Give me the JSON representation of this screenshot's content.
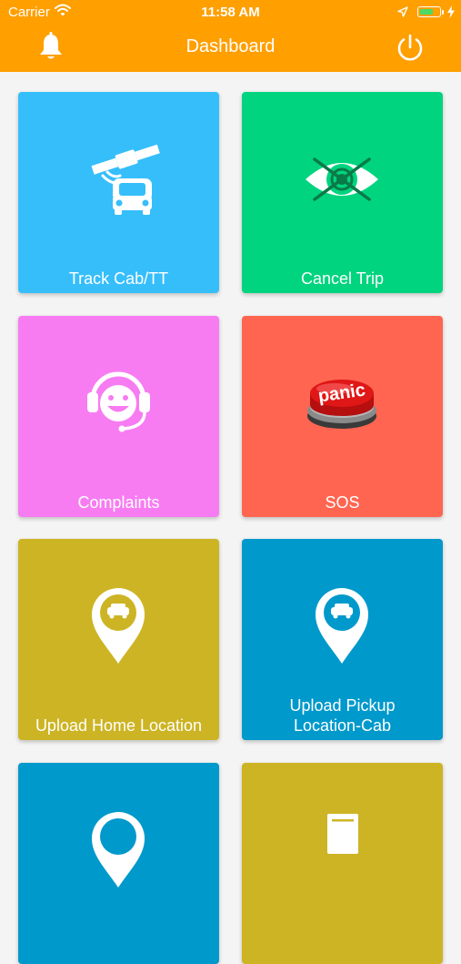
{
  "status_bar": {
    "carrier": "Carrier",
    "time": "11:58 AM",
    "battery_level": 0.72
  },
  "header": {
    "title": "Dashboard",
    "left_icon": "bell-icon",
    "right_icon": "power-icon",
    "background": "#FF9F00"
  },
  "tiles": [
    {
      "label": "Track Cab/TT",
      "icon": "satellite-car-icon",
      "color": "#36BEFA"
    },
    {
      "label": "Cancel Trip",
      "icon": "crossed-eye-icon",
      "color": "#00D47F"
    },
    {
      "label": "Complaints",
      "icon": "headset-smiley-icon",
      "color": "#F77CF2"
    },
    {
      "label": "SOS",
      "icon": "panic-button-icon",
      "color": "#FF6550",
      "icon_text": "panic"
    },
    {
      "label": "Upload Home Location",
      "icon": "car-location-pin-icon",
      "color": "#CDB424"
    },
    {
      "label_line1": "Upload Pickup",
      "label_line2": "Location-Cab",
      "icon": "car-location-pin-icon",
      "color": "#0099CC"
    },
    {
      "label": "",
      "icon": "location-pin-icon",
      "color": "#0099CC"
    },
    {
      "label": "",
      "icon": "document-icon",
      "color": "#CDB424"
    }
  ]
}
